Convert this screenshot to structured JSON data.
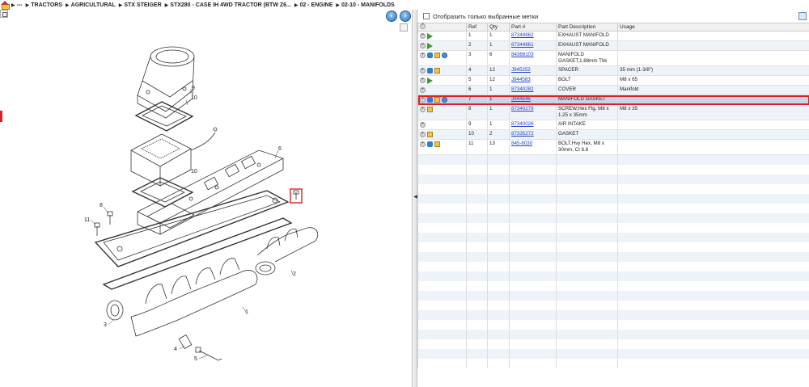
{
  "breadcrumb": [
    "---",
    "TRACTORS",
    "AGRICULTURAL",
    "STX STEIGER",
    "STX280 - CASE IH 4WD TRACTOR (BTW Z6...",
    "02 - ENGINE",
    "02-10 - MANIFOLDS"
  ],
  "filter": {
    "label": "Отобразить только выбранные метки"
  },
  "table": {
    "headers": {
      "ref": "Ref",
      "qty": "Qty",
      "part": "Part #",
      "desc": "Part Description",
      "usage": "Usage"
    },
    "rows": [
      {
        "ref": "1",
        "qty": "1",
        "part": "87344862",
        "desc": "EXHAUST MANIFOLD",
        "usage": "",
        "icons": [
          "plus",
          "green"
        ]
      },
      {
        "ref": "2",
        "qty": "1",
        "part": "87344861",
        "desc": "EXHAUST MANIFOLD",
        "usage": "",
        "icons": [
          "plus",
          "green"
        ]
      },
      {
        "ref": "3",
        "qty": "6",
        "part": "84368103",
        "desc": "MANIFOLD GASKET,1.88mm Thk",
        "usage": "",
        "icons": [
          "plus",
          "blue",
          "box",
          "globe"
        ]
      },
      {
        "ref": "4",
        "qty": "12",
        "part": "J945252",
        "desc": "SPACER",
        "usage": "35 mm (1-3/8\")",
        "icons": [
          "plus",
          "blue",
          "box"
        ]
      },
      {
        "ref": "5",
        "qty": "12",
        "part": "J944583",
        "desc": "BOLT",
        "usage": "M8 x 65",
        "icons": [
          "plus",
          "green"
        ]
      },
      {
        "ref": "6",
        "qty": "1",
        "part": "87340282",
        "desc": "COVER",
        "usage": "Manifold",
        "icons": [
          "plus"
        ]
      },
      {
        "ref": "7",
        "qty": "1",
        "part": "J944646",
        "desc": "MANIFOLD GASKET",
        "usage": "",
        "icons": [
          "plus",
          "blue",
          "box",
          "globe"
        ]
      },
      {
        "ref": "8",
        "qty": "1",
        "part": "87340279",
        "desc": "SCREW,Hex Flg, M8 x 1.25 x 35mm",
        "usage": "M8 x 35",
        "icons": [
          "plus",
          "box"
        ]
      },
      {
        "ref": "9",
        "qty": "1",
        "part": "87340026",
        "desc": "AIR INTAKE",
        "usage": "",
        "icons": [
          "plus"
        ]
      },
      {
        "ref": "10",
        "qty": "2",
        "part": "87335272",
        "desc": "GASKET",
        "usage": "",
        "icons": [
          "plus",
          "box"
        ]
      },
      {
        "ref": "11",
        "qty": "13",
        "part": "845-8030",
        "desc": "BOLT,Hvy Hex, M8 x 30mm, CI 8.8",
        "usage": "",
        "icons": [
          "plus",
          "blue",
          "box"
        ]
      }
    ],
    "selected_ref": "7"
  },
  "diagram": {
    "callouts": [
      "1",
      "2",
      "3",
      "4",
      "5",
      "6",
      "7",
      "8",
      "9",
      "10",
      "10",
      "11"
    ]
  },
  "colors": {
    "selection_outline": "#e02020",
    "link": "#1a3fcc",
    "row_alt": "#eef3f9",
    "row_selected": "#c6d5ea"
  }
}
